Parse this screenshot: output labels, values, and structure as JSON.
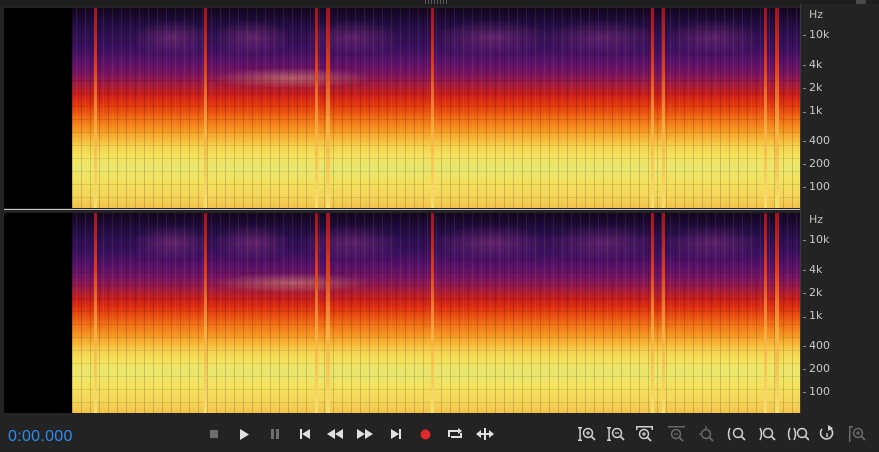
{
  "time": "0:00.000",
  "ruler": {
    "unit": "Hz",
    "labels": [
      "10k",
      "4k",
      "2k",
      "1k",
      "400",
      "200",
      "100"
    ]
  },
  "channels": [
    "channel-1",
    "channel-2"
  ],
  "transport": {
    "buttons": [
      {
        "name": "stop-button",
        "icon": "stop-icon",
        "enabled": false
      },
      {
        "name": "play-button",
        "icon": "play-icon",
        "enabled": true
      },
      {
        "name": "pause-button",
        "icon": "pause-icon",
        "enabled": false
      },
      {
        "name": "go-to-start-button",
        "icon": "skip-back-icon",
        "enabled": true
      },
      {
        "name": "rewind-button",
        "icon": "rewind-icon",
        "enabled": true
      },
      {
        "name": "fast-forward-button",
        "icon": "fast-forward-icon",
        "enabled": true
      },
      {
        "name": "go-to-end-button",
        "icon": "skip-forward-icon",
        "enabled": true
      },
      {
        "name": "record-button",
        "icon": "record-icon",
        "enabled": true
      },
      {
        "name": "loop-button",
        "icon": "loop-icon",
        "enabled": true
      },
      {
        "name": "skip-selection-button",
        "icon": "skip-selection-icon",
        "enabled": true
      }
    ]
  },
  "zoom": {
    "buttons": [
      {
        "name": "zoom-in-amplitude-button",
        "icon": "zoom-in-amplitude-icon",
        "enabled": true
      },
      {
        "name": "zoom-out-amplitude-button",
        "icon": "zoom-out-amplitude-icon",
        "enabled": true
      },
      {
        "name": "zoom-in-time-button",
        "icon": "zoom-in-time-icon",
        "enabled": true
      },
      {
        "name": "zoom-out-time-button",
        "icon": "zoom-out-time-icon",
        "enabled": false
      },
      {
        "name": "zoom-out-full-button",
        "icon": "zoom-out-full-icon",
        "enabled": false
      },
      {
        "name": "zoom-in-at-start-button",
        "icon": "zoom-in-start-icon",
        "enabled": true
      },
      {
        "name": "zoom-in-at-end-button",
        "icon": "zoom-in-end-icon",
        "enabled": true
      },
      {
        "name": "zoom-to-selection-button",
        "icon": "zoom-selection-icon",
        "enabled": true
      },
      {
        "name": "zoom-reset-button",
        "icon": "zoom-reset-icon",
        "enabled": true
      },
      {
        "name": "zoom-selected-tracks-button",
        "icon": "zoom-tracks-icon",
        "enabled": false
      }
    ]
  },
  "colors": {
    "accent": "#2d8ceb",
    "record": "#e02a2a",
    "background": "#232323"
  }
}
